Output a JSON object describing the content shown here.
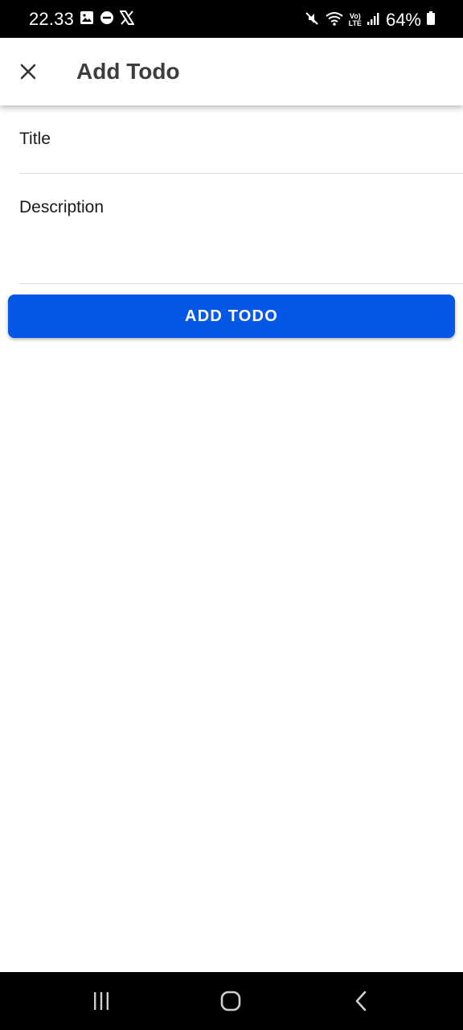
{
  "status_bar": {
    "time": "22.33",
    "battery": "64%",
    "lte_top": "Vo)",
    "lte_bottom": "LTE",
    "left_icons": [
      "gallery-icon",
      "do-not-disturb-icon",
      "x-logo-icon"
    ],
    "right_icons": [
      "mute-icon",
      "wifi-icon",
      "signal-icon",
      "battery-icon"
    ]
  },
  "app_bar": {
    "title": "Add Todo",
    "close_icon": "close-icon"
  },
  "form": {
    "title_label": "Title",
    "description_label": "Description",
    "submit_label": "ADD TODO"
  },
  "colors": {
    "primary": "#0557e8",
    "status_bar_bg": "#000000",
    "nav_bar_bg": "#000000",
    "title_text": "#3d3d3d"
  },
  "nav_bar": {
    "icons": [
      "recent-apps-icon",
      "home-icon",
      "back-icon"
    ]
  }
}
